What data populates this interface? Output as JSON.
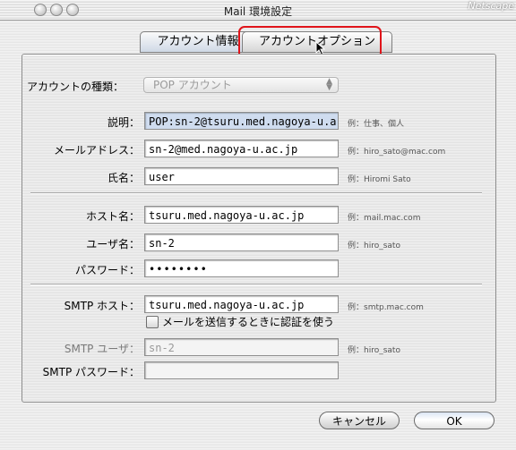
{
  "window": {
    "title": "Mail 環境設定",
    "background_app_label": "Netscape"
  },
  "tabs": [
    {
      "label": "アカウント情報",
      "active": true
    },
    {
      "label": "アカウントオプション",
      "active": false
    }
  ],
  "account_type": {
    "label": "アカウントの種類：",
    "value": "POP アカウント"
  },
  "fields": {
    "description": {
      "label": "説明：",
      "value": "POP:sn-2@tsuru.med.nagoya-u.a",
      "example": "例：仕事、個人"
    },
    "email": {
      "label": "メールアドレス：",
      "value": "sn-2@med.nagoya-u.ac.jp",
      "example": "例：hiro_sato@mac.com"
    },
    "full_name": {
      "label": "氏名：",
      "value": "user",
      "example": "例：Hiromi Sato"
    },
    "host": {
      "label": "ホスト名：",
      "value": "tsuru.med.nagoya-u.ac.jp",
      "example": "例：mail.mac.com"
    },
    "username": {
      "label": "ユーザ名：",
      "value": "sn-2",
      "example": "例：hiro_sato"
    },
    "password": {
      "label": "パスワード：",
      "value": "••••••••"
    },
    "smtp_host": {
      "label": "SMTP ホスト：",
      "value": "tsuru.med.nagoya-u.ac.jp",
      "example": "例：smtp.mac.com"
    },
    "smtp_user": {
      "label": "SMTP ユーザ：",
      "value": "sn-2",
      "example": "例：hiro_sato"
    },
    "smtp_password": {
      "label": "SMTP パスワード：",
      "value": ""
    }
  },
  "smtp_auth_checkbox": {
    "label": "メールを送信するときに認証を使う",
    "checked": false
  },
  "buttons": {
    "cancel": "キャンセル",
    "ok": "OK"
  },
  "colors": {
    "highlight_ring": "#e0141a",
    "default_button": "#dbe6f4"
  }
}
